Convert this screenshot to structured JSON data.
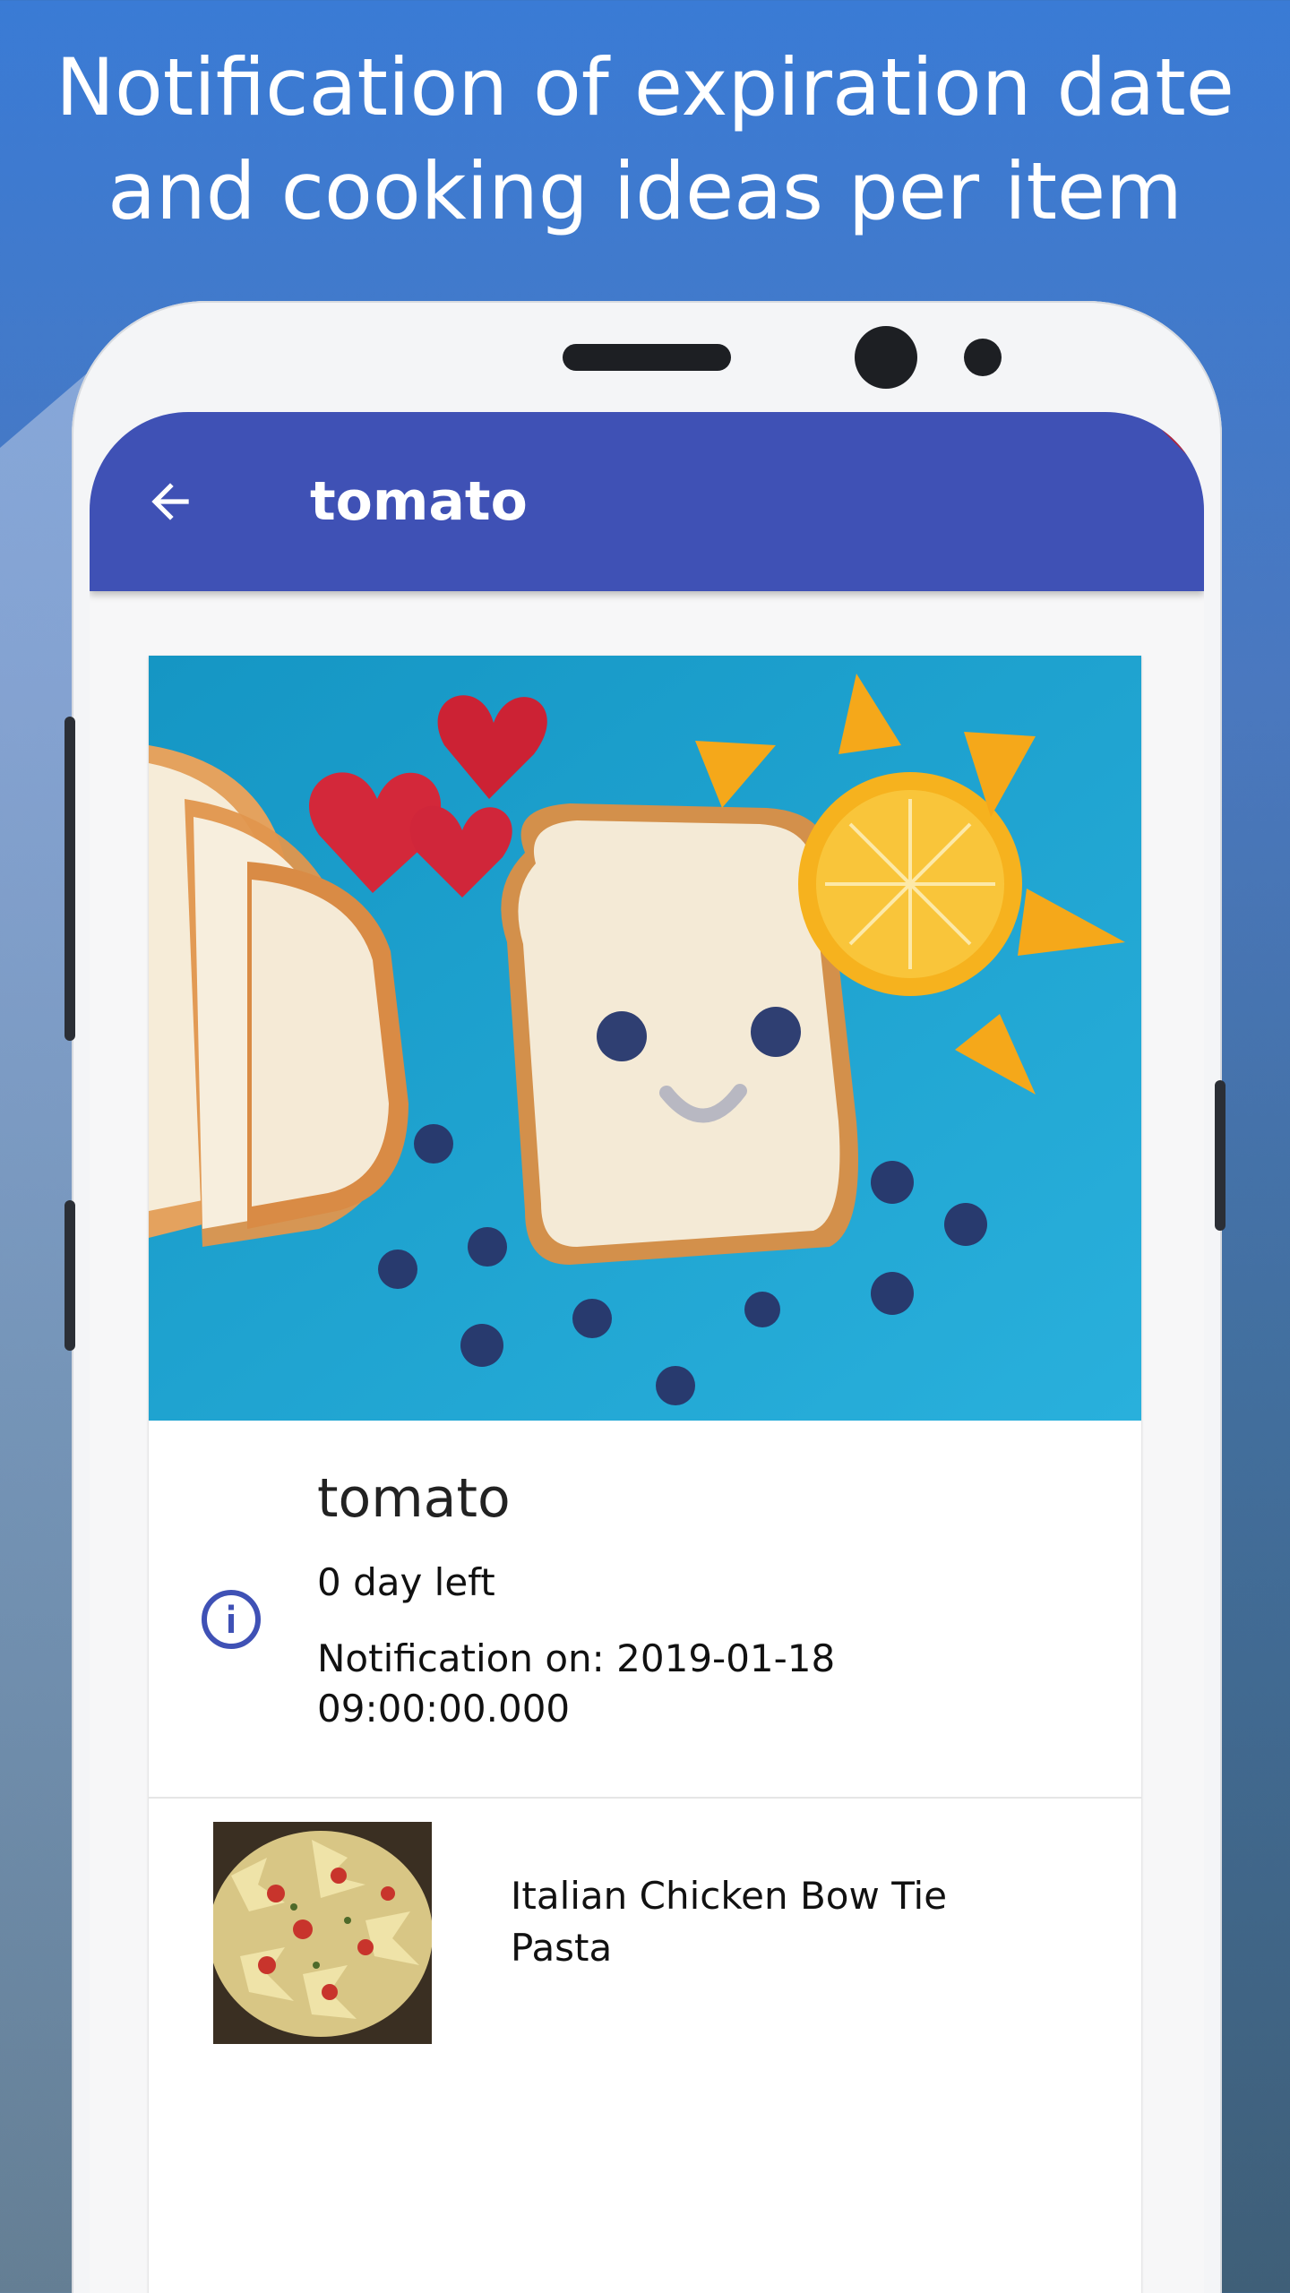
{
  "promo": {
    "headline_line1": "Notification of expiration date",
    "headline_line2": "and cooking ideas per item"
  },
  "appbar": {
    "title": "tomato",
    "back_icon": "arrow-left-icon",
    "color": "#3f51b5"
  },
  "item": {
    "name": "tomato",
    "days_left": "0 day left",
    "notification_line1": "Notification on: 2019-01-18",
    "notification_line2": "09:00:00.000",
    "info_icon": "info-circle-icon",
    "hero_image": "bread-face-breakfast-photo"
  },
  "recipes": [
    {
      "title": "Italian Chicken Bow Tie Pasta",
      "thumbnail": "bow-tie-pasta-photo"
    }
  ]
}
